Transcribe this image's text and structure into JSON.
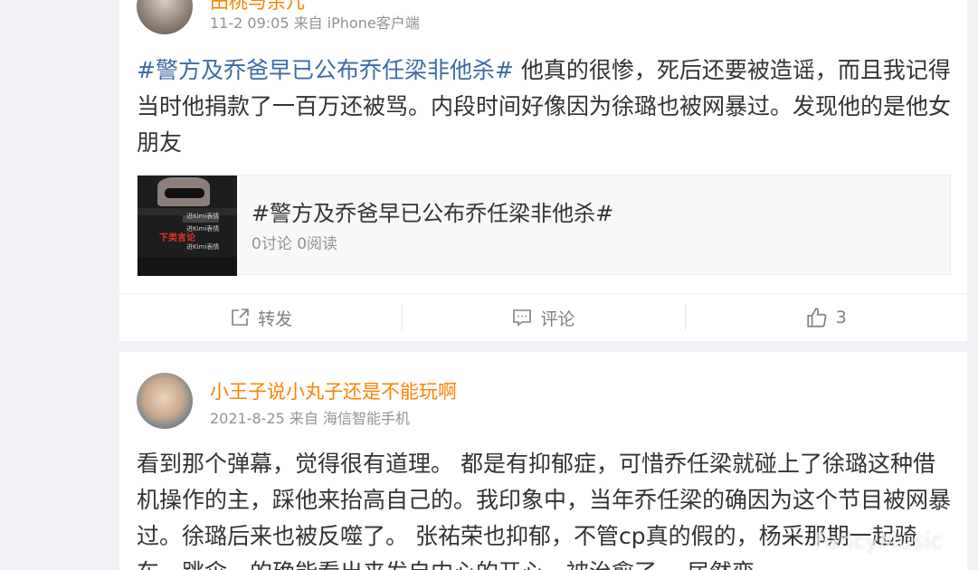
{
  "posts": [
    {
      "username": "田桃与余儿",
      "meta": "11-2 09:05 来自 iPhone客户端",
      "hashtag": "#警方及乔爸早已公布乔任梁非他杀#",
      "text": " 他真的很惨，死后还要被造谣，而且我记得当时他捐款了一百万还被骂。内段时间好像因为徐璐也被网暴过。发现他的是他女朋友",
      "topic": {
        "title": "#警方及乔爸早已公布乔任梁非他杀#",
        "stats": "0讨论 0阅读",
        "thumb_red": "下类言论",
        "thumb_texts": [
          "进Kimi表情",
          "进Kimi表情",
          "进Kimi表情"
        ]
      },
      "actions": {
        "repost_label": "转发",
        "comment_label": "评论",
        "like_count": "3"
      }
    },
    {
      "username": "小王子说小丸子还是不能玩啊",
      "meta": "2021-8-25 来自 海信智能手机",
      "text": "看到那个弹幕，觉得很有道理。 都是有抑郁症，可惜乔任梁就碰上了徐璐这种借机操作的主，踩他来抬高自己的。我印象中，当年乔任梁的确因为这个节目被网暴过。徐璐后来也被反噬了。 张祐荣也抑郁，不管cp真的假的，杨采那期一起骑车，跳伞，的确能看出来发自内心的开心，被治愈了。 居然变"
    }
  ],
  "watermark": "FancyMusic",
  "colors": {
    "username": "#ff8200",
    "hashtag": "#3d6ba6",
    "meta": "#939393",
    "background": "#f1f2f5"
  },
  "icons": {
    "repost": "share-box-icon",
    "comment": "comment-bubble-icon",
    "like": "thumbs-up-icon"
  }
}
